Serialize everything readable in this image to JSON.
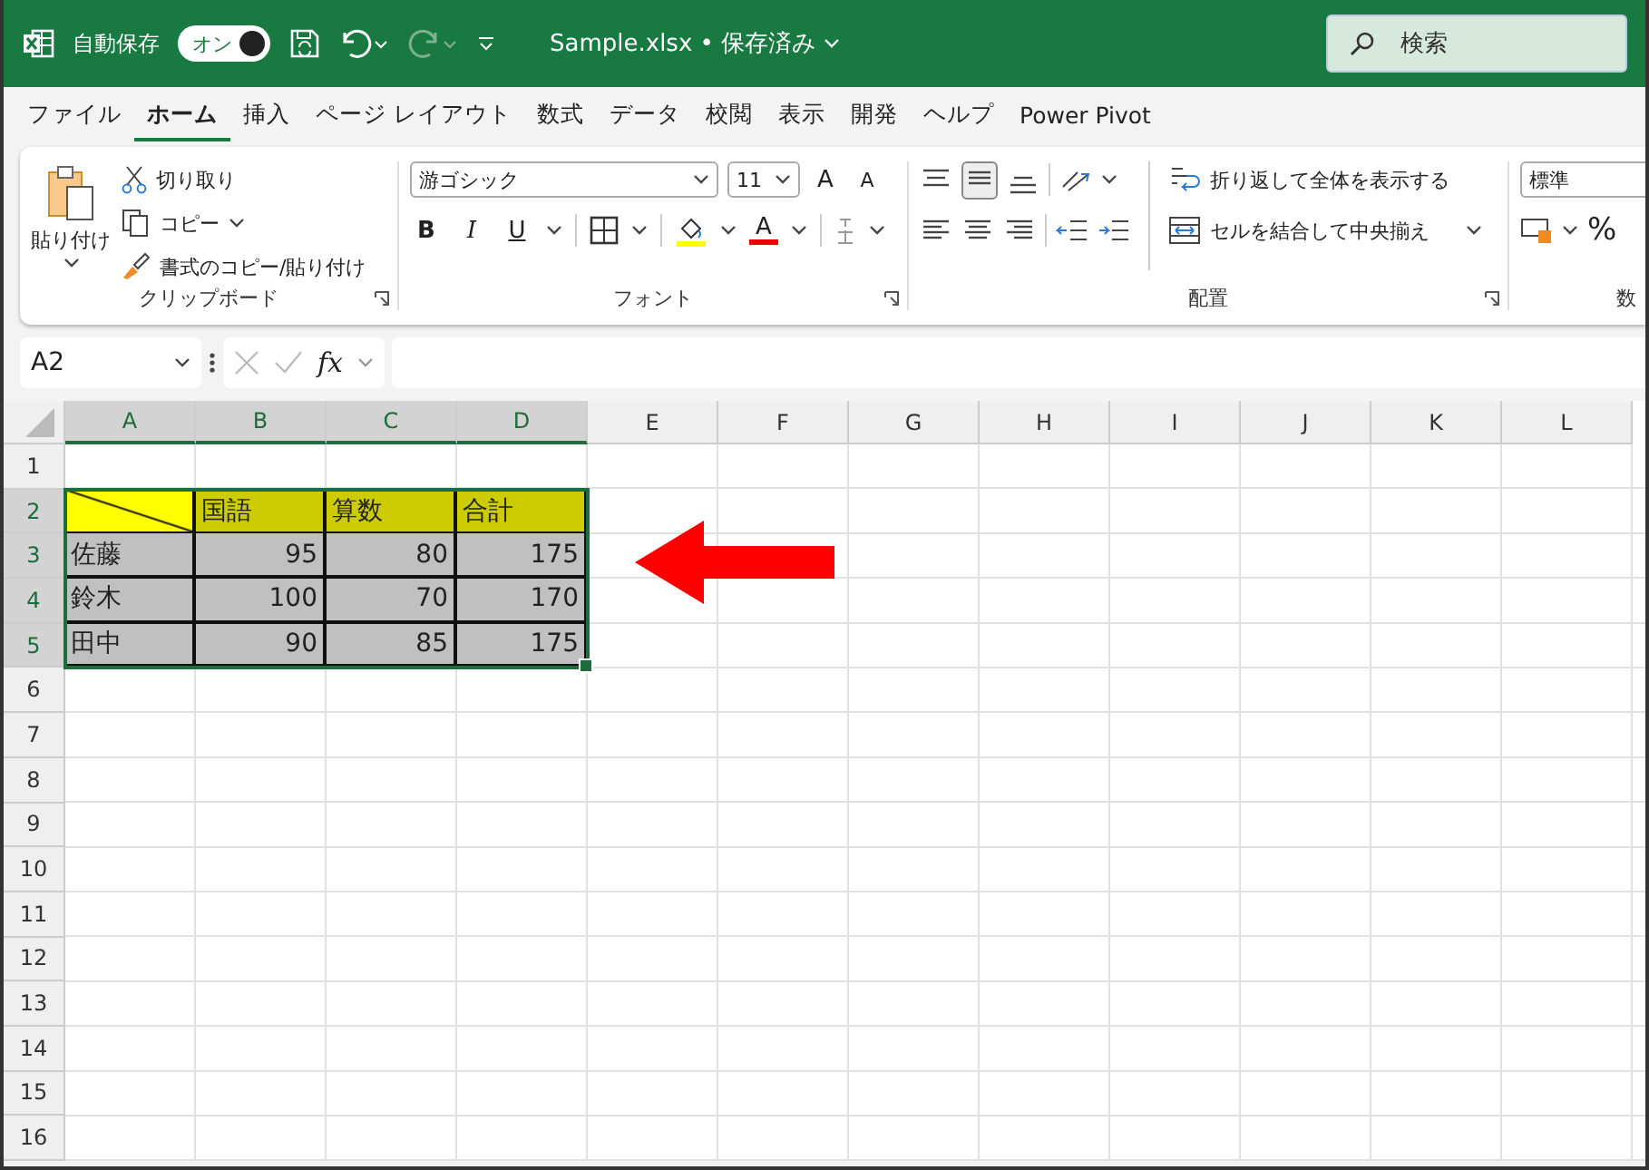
{
  "title_bar": {
    "autosave_label": "自動保存",
    "autosave_toggle": {
      "label": "オン",
      "on": true
    },
    "file_title": "Sample.xlsx • 保存済み",
    "search": {
      "placeholder": "検索"
    }
  },
  "menu_tabs": [
    {
      "label": "ファイル",
      "selected": false
    },
    {
      "label": "ホーム",
      "selected": true
    },
    {
      "label": "挿入",
      "selected": false
    },
    {
      "label": "ページ レイアウト",
      "selected": false
    },
    {
      "label": "数式",
      "selected": false
    },
    {
      "label": "データ",
      "selected": false
    },
    {
      "label": "校閲",
      "selected": false
    },
    {
      "label": "表示",
      "selected": false
    },
    {
      "label": "開発",
      "selected": false
    },
    {
      "label": "ヘルプ",
      "selected": false
    },
    {
      "label": "Power Pivot",
      "selected": false
    }
  ],
  "ribbon": {
    "clipboard": {
      "paste": "貼り付け",
      "cut": "切り取り",
      "copy": "コピー",
      "format_painter": "書式のコピー/貼り付け",
      "label": "クリップボード"
    },
    "font": {
      "font_name": "游ゴシック",
      "font_size": "11",
      "grow_font": "A",
      "shrink_font": "A",
      "bold": "B",
      "italic": "I",
      "underline": "U",
      "font_color": "A",
      "label": "フォント"
    },
    "alignment": {
      "wrap_text": "折り返して全体を表示する",
      "merge_center": "セルを結合して中央揃え",
      "label": "配置"
    },
    "number": {
      "format": "標準",
      "percent": "%",
      "label": "数"
    }
  },
  "formula_bar": {
    "name_box": "A2",
    "function_label": "fx"
  },
  "sheet": {
    "columns": [
      {
        "label": "A",
        "selected": true
      },
      {
        "label": "B",
        "selected": true
      },
      {
        "label": "C",
        "selected": true
      },
      {
        "label": "D",
        "selected": true
      },
      {
        "label": "E",
        "selected": false
      },
      {
        "label": "F",
        "selected": false
      },
      {
        "label": "G",
        "selected": false
      },
      {
        "label": "H",
        "selected": false
      },
      {
        "label": "I",
        "selected": false
      },
      {
        "label": "J",
        "selected": false
      },
      {
        "label": "K",
        "selected": false
      },
      {
        "label": "L",
        "selected": false
      }
    ],
    "rows": [
      {
        "label": "1",
        "selected": false
      },
      {
        "label": "2",
        "selected": true,
        "cells": [
          {
            "kind": "corner"
          },
          {
            "kind": "header",
            "text": "国語"
          },
          {
            "kind": "header",
            "text": "算数"
          },
          {
            "kind": "header",
            "text": "合計"
          }
        ]
      },
      {
        "label": "3",
        "selected": true,
        "cells": [
          {
            "kind": "name",
            "text": "佐藤"
          },
          {
            "kind": "number",
            "text": "95"
          },
          {
            "kind": "number",
            "text": "80"
          },
          {
            "kind": "number",
            "text": "175"
          }
        ]
      },
      {
        "label": "4",
        "selected": true,
        "cells": [
          {
            "kind": "name",
            "text": "鈴木"
          },
          {
            "kind": "number",
            "text": "100"
          },
          {
            "kind": "number",
            "text": "70"
          },
          {
            "kind": "number",
            "text": "170"
          }
        ]
      },
      {
        "label": "5",
        "selected": true,
        "cells": [
          {
            "kind": "name",
            "text": "田中"
          },
          {
            "kind": "number",
            "text": "90"
          },
          {
            "kind": "number",
            "text": "85"
          },
          {
            "kind": "number",
            "text": "175"
          }
        ]
      },
      {
        "label": "6",
        "selected": false
      },
      {
        "label": "7",
        "selected": false
      },
      {
        "label": "8",
        "selected": false
      },
      {
        "label": "9",
        "selected": false
      },
      {
        "label": "10",
        "selected": false
      },
      {
        "label": "11",
        "selected": false
      },
      {
        "label": "12",
        "selected": false
      },
      {
        "label": "13",
        "selected": false
      },
      {
        "label": "14",
        "selected": false
      },
      {
        "label": "15",
        "selected": false
      },
      {
        "label": "16",
        "selected": false
      }
    ]
  }
}
